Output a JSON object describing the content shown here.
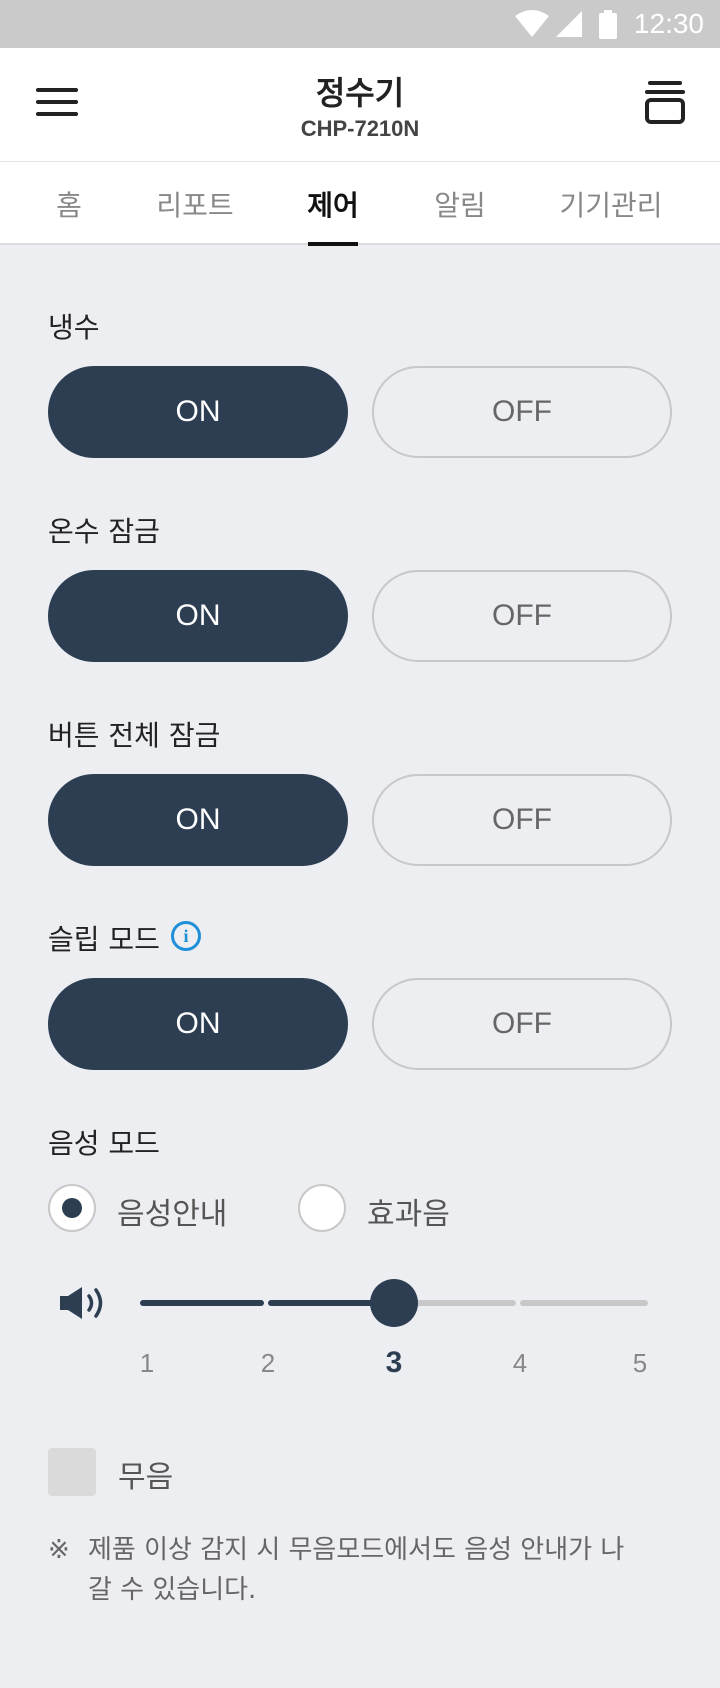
{
  "status_bar": {
    "time": "12:30",
    "icons": [
      "wifi-icon",
      "signal-icon",
      "battery-icon"
    ]
  },
  "app_bar": {
    "title": "정수기",
    "subtitle": "CHP-7210N",
    "menu_icon": "hamburger-menu-icon",
    "action_icon": "device-stack-icon"
  },
  "tabs": [
    {
      "label": "홈",
      "active": false
    },
    {
      "label": "리포트",
      "active": false
    },
    {
      "label": "제어",
      "active": true
    },
    {
      "label": "알림",
      "active": false
    },
    {
      "label": "기기관리",
      "active": false
    }
  ],
  "controls": {
    "cold_water": {
      "label": "냉수",
      "on_label": "ON",
      "off_label": "OFF",
      "value": "ON"
    },
    "hot_water_lock": {
      "label": "온수 잠금",
      "on_label": "ON",
      "off_label": "OFF",
      "value": "ON"
    },
    "button_lock": {
      "label": "버튼 전체 잠금",
      "on_label": "ON",
      "off_label": "OFF",
      "value": "ON"
    },
    "sleep_mode": {
      "label": "슬립 모드",
      "on_label": "ON",
      "off_label": "OFF",
      "value": "ON",
      "info_icon": "info-icon"
    }
  },
  "voice_mode": {
    "label": "음성 모드",
    "options": [
      {
        "label": "음성안내",
        "selected": true
      },
      {
        "label": "효과음",
        "selected": false
      }
    ],
    "volume": {
      "icon": "speaker-icon",
      "levels": [
        "1",
        "2",
        "3",
        "4",
        "5"
      ],
      "value": 3
    }
  },
  "mute": {
    "label": "무음",
    "checked": false
  },
  "note": {
    "mark": "※",
    "text": "제품 이상 감지 시 무음모드에서도 음성 안내가 나갈 수 있습니다."
  },
  "colors": {
    "primary": "#2d3e53",
    "info": "#1e90d8",
    "background": "#edeef2"
  }
}
